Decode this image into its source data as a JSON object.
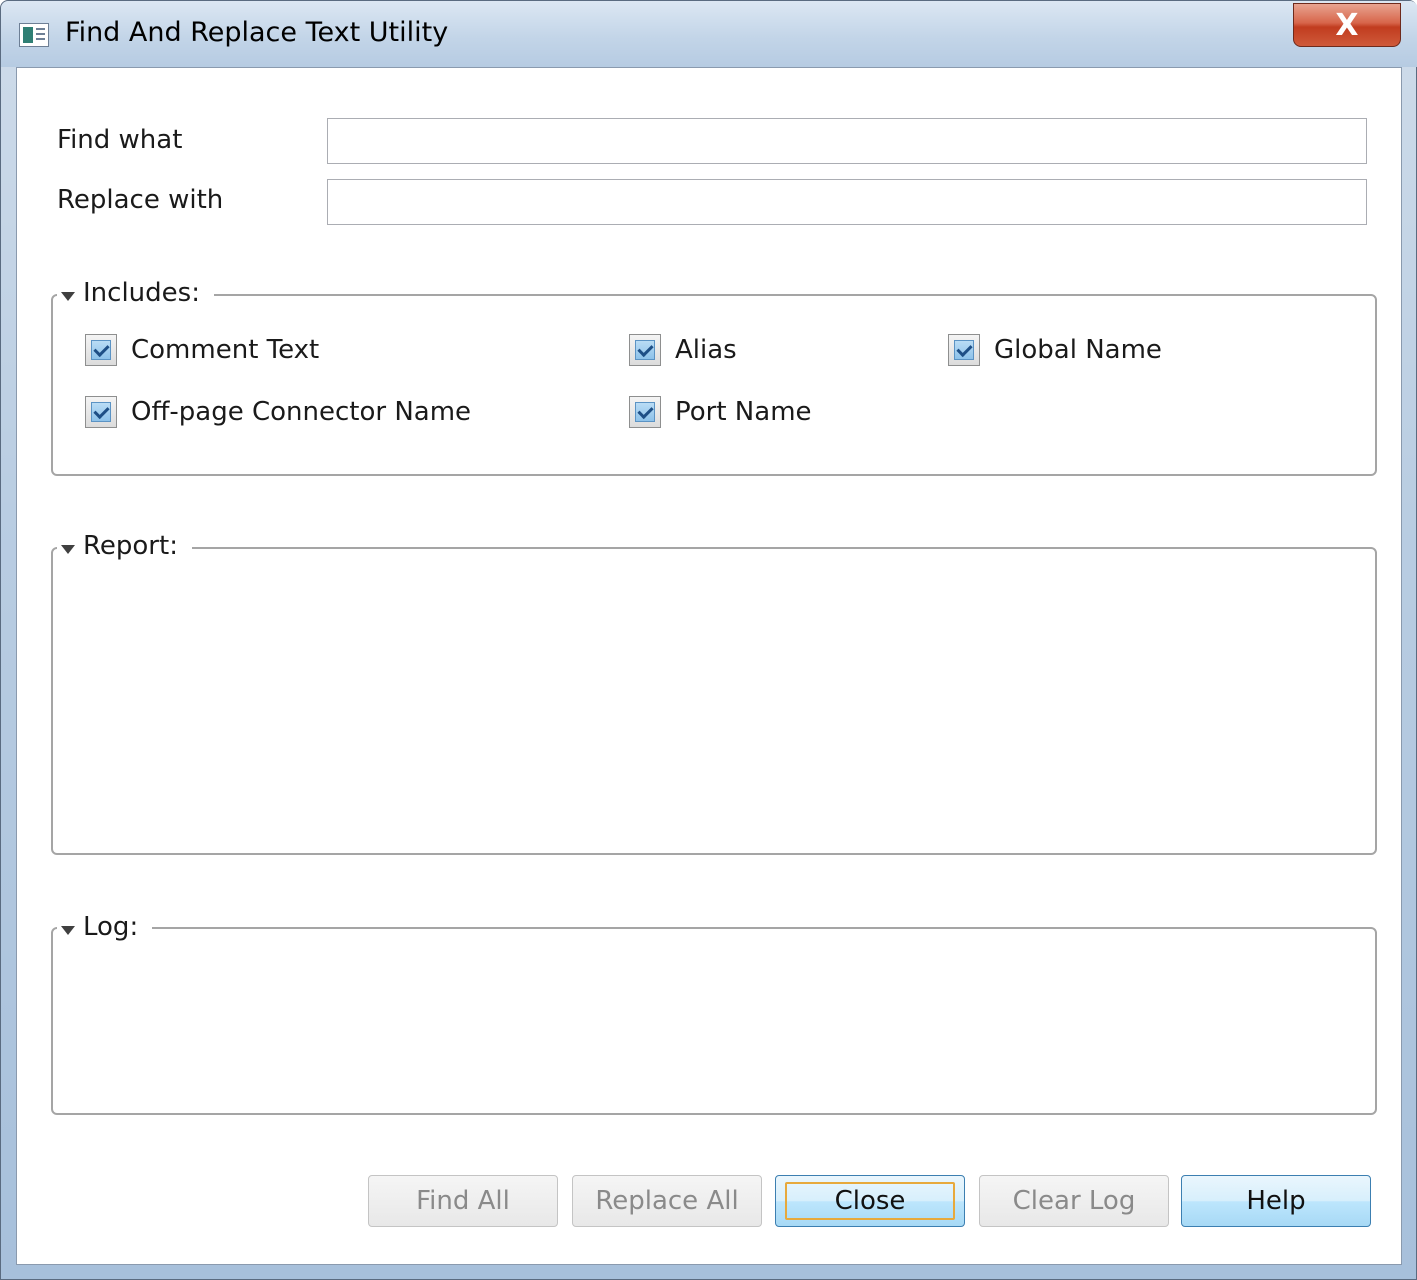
{
  "window": {
    "title": "Find And Replace Text Utility",
    "close_glyph": "X"
  },
  "fields": {
    "find_label": "Find what",
    "find_value": "",
    "replace_label": "Replace with",
    "replace_value": ""
  },
  "includes": {
    "title": "Includes:",
    "options": [
      {
        "label": "Comment Text",
        "checked": true
      },
      {
        "label": "Alias",
        "checked": true
      },
      {
        "label": "Global Name",
        "checked": true
      },
      {
        "label": "Off-page Connector Name",
        "checked": true
      },
      {
        "label": "Port Name",
        "checked": true
      }
    ]
  },
  "report": {
    "title": "Report:"
  },
  "log": {
    "title": "Log:"
  },
  "buttons": {
    "find_all": "Find All",
    "replace_all": "Replace All",
    "close": "Close",
    "clear_log": "Clear Log",
    "help": "Help"
  },
  "colors": {
    "focus_ring": "#e7a93c",
    "checkbox_check": "#1e4f86",
    "close_button": "#c13c1f"
  }
}
